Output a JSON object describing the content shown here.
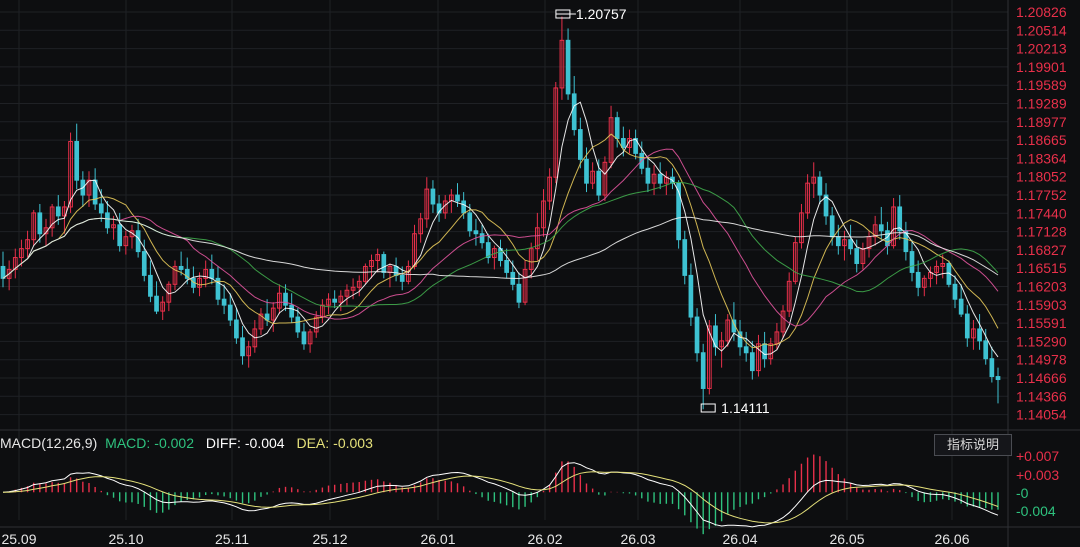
{
  "chart_data": [
    {
      "type": "candlestick",
      "extremes": {
        "high_label": "1.20757",
        "low_label": "1.14111"
      },
      "y_ticks": [
        "1.20826",
        "1.20514",
        "1.20213",
        "1.19901",
        "1.19589",
        "1.19289",
        "1.18977",
        "1.18665",
        "1.18364",
        "1.18052",
        "1.17752",
        "1.17440",
        "1.17128",
        "1.16827",
        "1.16515",
        "1.16203",
        "1.15903",
        "1.15591",
        "1.15290",
        "1.14978",
        "1.14666",
        "1.14366",
        "1.14054"
      ],
      "ylim": [
        1.14054,
        1.20826
      ],
      "x_ticks": [
        "25.09",
        "25.10",
        "25.11",
        "25.12",
        "26.01",
        "26.02",
        "26.03",
        "26.04",
        "26.05",
        "26.06"
      ],
      "candles": [
        [
          1.1655,
          1.168,
          1.162,
          1.1635
        ],
        [
          1.1635,
          1.1665,
          1.1615,
          1.165
        ],
        [
          1.165,
          1.1685,
          1.1635,
          1.167
        ],
        [
          1.167,
          1.17,
          1.1655,
          1.1685
        ],
        [
          1.1685,
          1.1715,
          1.167,
          1.17
        ],
        [
          1.17,
          1.175,
          1.169,
          1.1745
        ],
        [
          1.1745,
          1.176,
          1.1695,
          1.171
        ],
        [
          1.171,
          1.1735,
          1.169,
          1.172
        ],
        [
          1.172,
          1.176,
          1.1705,
          1.1755
        ],
        [
          1.1755,
          1.1775,
          1.1725,
          1.174
        ],
        [
          1.174,
          1.1765,
          1.171,
          1.1755
        ],
        [
          1.1755,
          1.188,
          1.1745,
          1.1865
        ],
        [
          1.1865,
          1.1895,
          1.1785,
          1.18
        ],
        [
          1.18,
          1.1815,
          1.1755,
          1.1775
        ],
        [
          1.1775,
          1.1815,
          1.1755,
          1.18
        ],
        [
          1.18,
          1.182,
          1.175,
          1.176
        ],
        [
          1.176,
          1.1785,
          1.173,
          1.1745
        ],
        [
          1.1745,
          1.1765,
          1.171,
          1.172
        ],
        [
          1.172,
          1.174,
          1.17,
          1.1725
        ],
        [
          1.1725,
          1.1745,
          1.168,
          1.169
        ],
        [
          1.169,
          1.1715,
          1.1675,
          1.1705
        ],
        [
          1.1705,
          1.1725,
          1.1685,
          1.1715
        ],
        [
          1.1715,
          1.1735,
          1.167,
          1.168
        ],
        [
          1.168,
          1.17,
          1.163,
          1.164
        ],
        [
          1.164,
          1.1665,
          1.1595,
          1.1605
        ],
        [
          1.1605,
          1.163,
          1.1575,
          1.158
        ],
        [
          1.158,
          1.1605,
          1.1565,
          1.1595
        ],
        [
          1.1595,
          1.163,
          1.158,
          1.1625
        ],
        [
          1.1625,
          1.1665,
          1.1615,
          1.1655
        ],
        [
          1.1655,
          1.168,
          1.164,
          1.165
        ],
        [
          1.165,
          1.167,
          1.1625,
          1.1635
        ],
        [
          1.1635,
          1.1655,
          1.161,
          1.162
        ],
        [
          1.162,
          1.1645,
          1.1605,
          1.1635
        ],
        [
          1.1635,
          1.1665,
          1.162,
          1.165
        ],
        [
          1.165,
          1.1675,
          1.1625,
          1.1635
        ],
        [
          1.1635,
          1.1655,
          1.159,
          1.16
        ],
        [
          1.16,
          1.1625,
          1.1575,
          1.159
        ],
        [
          1.159,
          1.161,
          1.1555,
          1.1565
        ],
        [
          1.1565,
          1.1585,
          1.1525,
          1.1535
        ],
        [
          1.1535,
          1.1555,
          1.149,
          1.1505
        ],
        [
          1.1505,
          1.153,
          1.1485,
          1.152
        ],
        [
          1.152,
          1.1565,
          1.151,
          1.155
        ],
        [
          1.155,
          1.1585,
          1.154,
          1.1575
        ],
        [
          1.1575,
          1.16,
          1.1555,
          1.1565
        ],
        [
          1.1565,
          1.1595,
          1.1545,
          1.1585
        ],
        [
          1.1585,
          1.1625,
          1.1575,
          1.161
        ],
        [
          1.161,
          1.1625,
          1.158,
          1.159
        ],
        [
          1.159,
          1.161,
          1.156,
          1.157
        ],
        [
          1.157,
          1.1585,
          1.1535,
          1.1545
        ],
        [
          1.1545,
          1.156,
          1.1515,
          1.1525
        ],
        [
          1.1525,
          1.155,
          1.151,
          1.1545
        ],
        [
          1.1545,
          1.158,
          1.1535,
          1.157
        ],
        [
          1.157,
          1.16,
          1.156,
          1.159
        ],
        [
          1.159,
          1.161,
          1.1575,
          1.16
        ],
        [
          1.16,
          1.1615,
          1.1585,
          1.1595
        ],
        [
          1.1595,
          1.1615,
          1.158,
          1.1605
        ],
        [
          1.1605,
          1.1625,
          1.159,
          1.1615
        ],
        [
          1.1615,
          1.1635,
          1.16,
          1.162
        ],
        [
          1.162,
          1.164,
          1.1605,
          1.163
        ],
        [
          1.163,
          1.166,
          1.1625,
          1.1655
        ],
        [
          1.1655,
          1.1675,
          1.1635,
          1.1665
        ],
        [
          1.1665,
          1.1685,
          1.1645,
          1.1675
        ],
        [
          1.1675,
          1.168,
          1.1635,
          1.1645
        ],
        [
          1.1645,
          1.166,
          1.162,
          1.1655
        ],
        [
          1.1655,
          1.167,
          1.163,
          1.164
        ],
        [
          1.164,
          1.1655,
          1.1615,
          1.163
        ],
        [
          1.163,
          1.1665,
          1.1625,
          1.1655
        ],
        [
          1.1655,
          1.1725,
          1.165,
          1.171
        ],
        [
          1.171,
          1.1745,
          1.1695,
          1.1735
        ],
        [
          1.1735,
          1.1805,
          1.172,
          1.1785
        ],
        [
          1.1785,
          1.18,
          1.1745,
          1.176
        ],
        [
          1.176,
          1.1775,
          1.173,
          1.1745
        ],
        [
          1.1745,
          1.1775,
          1.1735,
          1.1765
        ],
        [
          1.1765,
          1.1785,
          1.1745,
          1.1775
        ],
        [
          1.1775,
          1.1795,
          1.1755,
          1.1765
        ],
        [
          1.1765,
          1.178,
          1.1735,
          1.1745
        ],
        [
          1.1745,
          1.176,
          1.1705,
          1.1715
        ],
        [
          1.1715,
          1.1735,
          1.169,
          1.171
        ],
        [
          1.171,
          1.1725,
          1.1685,
          1.1695
        ],
        [
          1.1695,
          1.171,
          1.166,
          1.167
        ],
        [
          1.167,
          1.169,
          1.165,
          1.1685
        ],
        [
          1.1685,
          1.17,
          1.1655,
          1.1665
        ],
        [
          1.1665,
          1.1685,
          1.1635,
          1.1645
        ],
        [
          1.1645,
          1.1665,
          1.1615,
          1.1625
        ],
        [
          1.1625,
          1.1645,
          1.1585,
          1.1595
        ],
        [
          1.1595,
          1.1665,
          1.159,
          1.165
        ],
        [
          1.165,
          1.1695,
          1.1635,
          1.1685
        ],
        [
          1.1685,
          1.1745,
          1.1665,
          1.172
        ],
        [
          1.172,
          1.1785,
          1.1705,
          1.1765
        ],
        [
          1.1765,
          1.182,
          1.175,
          1.1805
        ],
        [
          1.1805,
          1.1965,
          1.1795,
          1.1955
        ],
        [
          1.1955,
          1.2075,
          1.1935,
          1.2035
        ],
        [
          1.2035,
          1.2055,
          1.1935,
          1.1945
        ],
        [
          1.1945,
          1.1975,
          1.1875,
          1.1885
        ],
        [
          1.1885,
          1.1905,
          1.182,
          1.1835
        ],
        [
          1.1835,
          1.1855,
          1.178,
          1.1795
        ],
        [
          1.1795,
          1.183,
          1.1785,
          1.1815
        ],
        [
          1.1815,
          1.1835,
          1.1765,
          1.1775
        ],
        [
          1.1775,
          1.184,
          1.1765,
          1.183
        ],
        [
          1.183,
          1.1925,
          1.182,
          1.1905
        ],
        [
          1.1905,
          1.1915,
          1.1855,
          1.187
        ],
        [
          1.187,
          1.189,
          1.184,
          1.1855
        ],
        [
          1.1855,
          1.1885,
          1.1845,
          1.187
        ],
        [
          1.187,
          1.1885,
          1.1835,
          1.1845
        ],
        [
          1.1845,
          1.1865,
          1.181,
          1.182
        ],
        [
          1.182,
          1.184,
          1.178,
          1.1795
        ],
        [
          1.1795,
          1.1825,
          1.1775,
          1.181
        ],
        [
          1.181,
          1.183,
          1.1785,
          1.1795
        ],
        [
          1.1795,
          1.1815,
          1.1775,
          1.1805
        ],
        [
          1.1805,
          1.182,
          1.1785,
          1.1795
        ],
        [
          1.1795,
          1.18,
          1.1685,
          1.17
        ],
        [
          1.17,
          1.1715,
          1.1625,
          1.164
        ],
        [
          1.164,
          1.166,
          1.1555,
          1.157
        ],
        [
          1.157,
          1.1585,
          1.1495,
          1.151
        ],
        [
          1.151,
          1.1525,
          1.1415,
          1.145
        ],
        [
          1.145,
          1.1565,
          1.144,
          1.1555
        ],
        [
          1.1555,
          1.1575,
          1.1505,
          1.152
        ],
        [
          1.152,
          1.1545,
          1.1485,
          1.153
        ],
        [
          1.153,
          1.1575,
          1.152,
          1.1565
        ],
        [
          1.1565,
          1.1595,
          1.153,
          1.1545
        ],
        [
          1.1545,
          1.1565,
          1.1505,
          1.152
        ],
        [
          1.152,
          1.1545,
          1.1495,
          1.151
        ],
        [
          1.151,
          1.153,
          1.1465,
          1.148
        ],
        [
          1.148,
          1.154,
          1.147,
          1.1525
        ],
        [
          1.1525,
          1.1545,
          1.1485,
          1.15
        ],
        [
          1.15,
          1.1535,
          1.149,
          1.1525
        ],
        [
          1.1525,
          1.156,
          1.1515,
          1.1545
        ],
        [
          1.1545,
          1.159,
          1.1535,
          1.158
        ],
        [
          1.158,
          1.1645,
          1.157,
          1.163
        ],
        [
          1.163,
          1.1705,
          1.1625,
          1.1695
        ],
        [
          1.1695,
          1.176,
          1.1685,
          1.1745
        ],
        [
          1.1745,
          1.181,
          1.1735,
          1.1795
        ],
        [
          1.1795,
          1.183,
          1.177,
          1.1805
        ],
        [
          1.1805,
          1.1815,
          1.176,
          1.1775
        ],
        [
          1.1775,
          1.1795,
          1.1725,
          1.174
        ],
        [
          1.174,
          1.1755,
          1.169,
          1.1705
        ],
        [
          1.1705,
          1.1725,
          1.1675,
          1.169
        ],
        [
          1.169,
          1.1715,
          1.1665,
          1.17
        ],
        [
          1.17,
          1.1725,
          1.1675,
          1.1685
        ],
        [
          1.1685,
          1.17,
          1.1645,
          1.166
        ],
        [
          1.166,
          1.1695,
          1.165,
          1.1685
        ],
        [
          1.1685,
          1.1715,
          1.167,
          1.1705
        ],
        [
          1.1705,
          1.174,
          1.169,
          1.1725
        ],
        [
          1.1725,
          1.1755,
          1.17,
          1.1715
        ],
        [
          1.1715,
          1.173,
          1.1675,
          1.169
        ],
        [
          1.169,
          1.177,
          1.1685,
          1.1755
        ],
        [
          1.1755,
          1.1775,
          1.17,
          1.1715
        ],
        [
          1.1715,
          1.173,
          1.1665,
          1.168
        ],
        [
          1.168,
          1.17,
          1.163,
          1.1645
        ],
        [
          1.1645,
          1.1665,
          1.1605,
          1.162
        ],
        [
          1.162,
          1.164,
          1.1605,
          1.1635
        ],
        [
          1.1635,
          1.1655,
          1.162,
          1.1645
        ],
        [
          1.1645,
          1.1665,
          1.1625,
          1.1655
        ],
        [
          1.1655,
          1.1675,
          1.1635,
          1.166
        ],
        [
          1.166,
          1.1665,
          1.162,
          1.1625
        ],
        [
          1.1625,
          1.164,
          1.1585,
          1.16
        ],
        [
          1.16,
          1.1625,
          1.157,
          1.1575
        ],
        [
          1.1575,
          1.159,
          1.152,
          1.1535
        ],
        [
          1.1535,
          1.1565,
          1.1515,
          1.155
        ],
        [
          1.155,
          1.1575,
          1.1515,
          1.153
        ],
        [
          1.153,
          1.155,
          1.149,
          1.15
        ],
        [
          1.15,
          1.152,
          1.146,
          1.147
        ],
        [
          1.147,
          1.1485,
          1.1425,
          1.1465
        ]
      ],
      "ma_colors": [
        "#ffffff",
        "#e4c85a",
        "#e0549c",
        "#3fa84b",
        "#ededed"
      ],
      "ma_periods": [
        5,
        10,
        20,
        30,
        60
      ],
      "up_color": "#e8304a",
      "down_color": "#3ec2d2"
    },
    {
      "type": "bar+line",
      "title": "MACD(12,26,9)",
      "macd_label": "MACD:",
      "macd_value": "-0.002",
      "diff_label": "DIFF:",
      "diff_value": "-0.004",
      "dea_label": "DEA:",
      "dea_value": "-0.003",
      "y_ticks": [
        "+0.007",
        "+0.003",
        "-0",
        "-0.004"
      ],
      "ylim": [
        -0.006,
        0.0085
      ],
      "colors": {
        "macd": "#2ec27e",
        "diff": "#ffffff",
        "dea": "#e4e07a",
        "pos": "#e8304a",
        "neg": "#2ec27e"
      }
    }
  ],
  "ui": {
    "explain_button": "指标说明"
  }
}
